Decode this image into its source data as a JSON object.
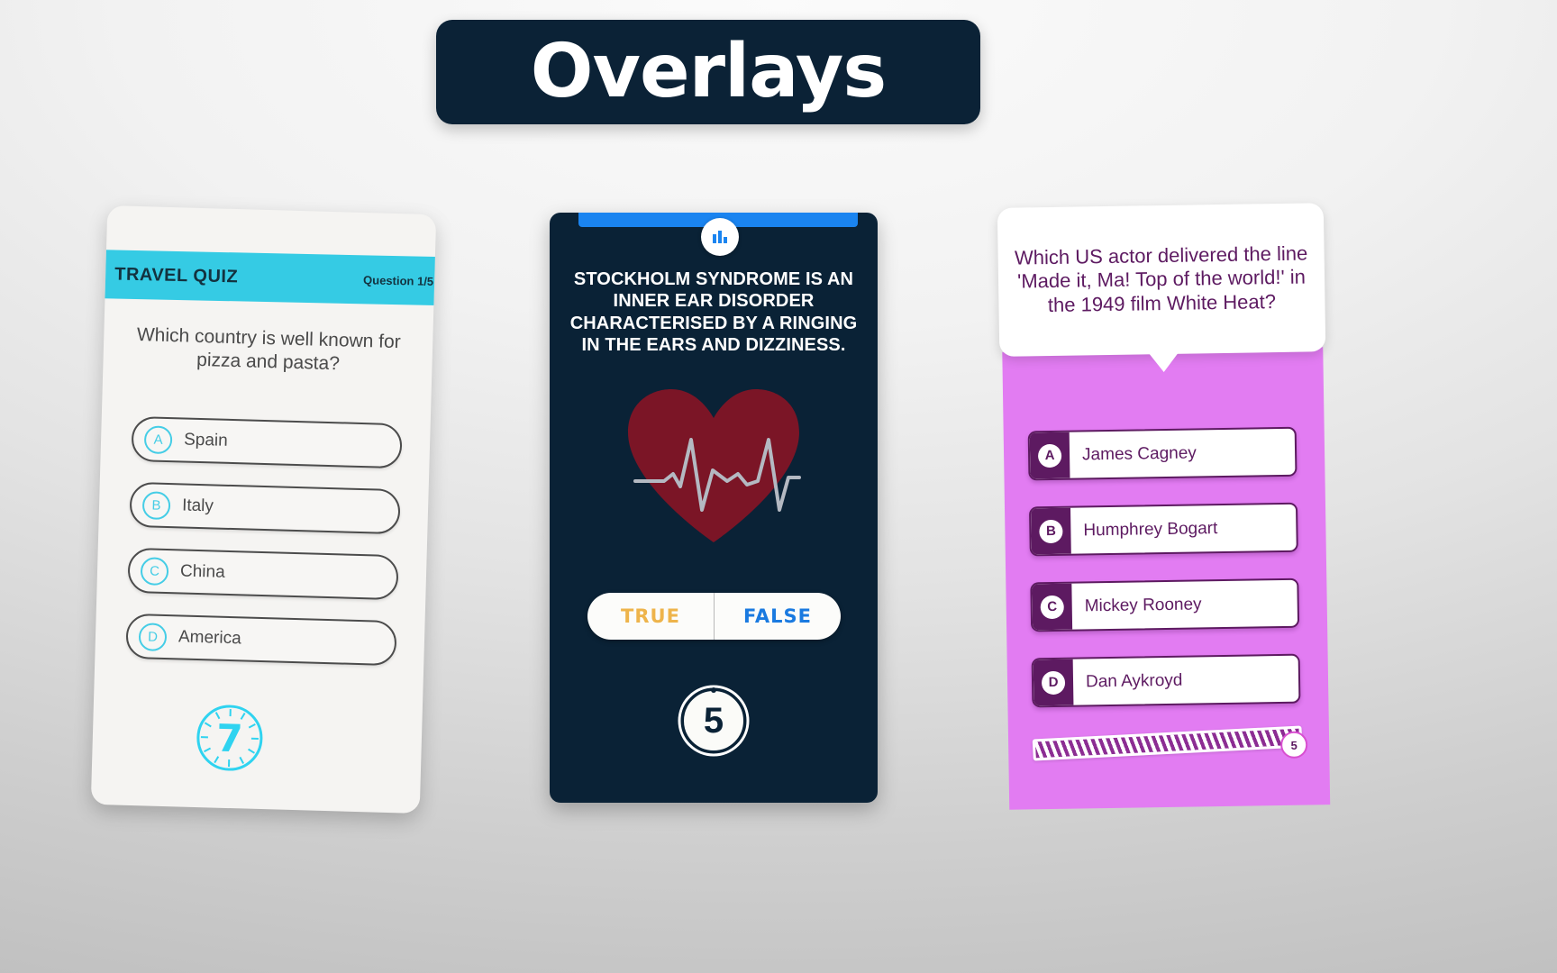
{
  "banner": {
    "title": "Overlays"
  },
  "card_travel": {
    "header_title": "TRAVEL QUIZ",
    "counter": "Question 1/5",
    "question": "Which country is well known for pizza and pasta?",
    "options": [
      {
        "letter": "A",
        "label": "Spain"
      },
      {
        "letter": "B",
        "label": "Italy"
      },
      {
        "letter": "C",
        "label": "China"
      },
      {
        "letter": "D",
        "label": "America"
      }
    ],
    "timer": "7",
    "colors": {
      "accent": "#35cbe4",
      "timer": "#2fd3f0",
      "text": "#4a4a4a"
    }
  },
  "card_truefalse": {
    "badge_icon": "bar-chart-icon",
    "statement": "STOCKHOLM SYNDROME IS AN INNER EAR DISORDER CHARACTERISED BY A RINGING IN THE EARS AND DIZZINESS.",
    "graphic": "heart-ekg-icon",
    "buttons": {
      "true_label": "TRUE",
      "false_label": "FALSE"
    },
    "countdown": "5",
    "colors": {
      "background": "#0a2236",
      "topbar": "#1a84f0",
      "true": "#eeb44b",
      "false": "#1a7ae0",
      "heart": "#7b1526"
    }
  },
  "card_actor": {
    "question": "Which US actor delivered the line 'Made it, Ma! Top of the world!' in the 1949 film White Heat?",
    "options": [
      {
        "letter": "A",
        "label": "James Cagney"
      },
      {
        "letter": "B",
        "label": "Humphrey Bogart"
      },
      {
        "letter": "C",
        "label": "Mickey Rooney"
      },
      {
        "letter": "D",
        "label": "Dan Aykroyd"
      }
    ],
    "progress_value": "5",
    "colors": {
      "background": "#e27cf2",
      "accent": "#5d1a61",
      "stripe": "#8c2d93"
    }
  }
}
